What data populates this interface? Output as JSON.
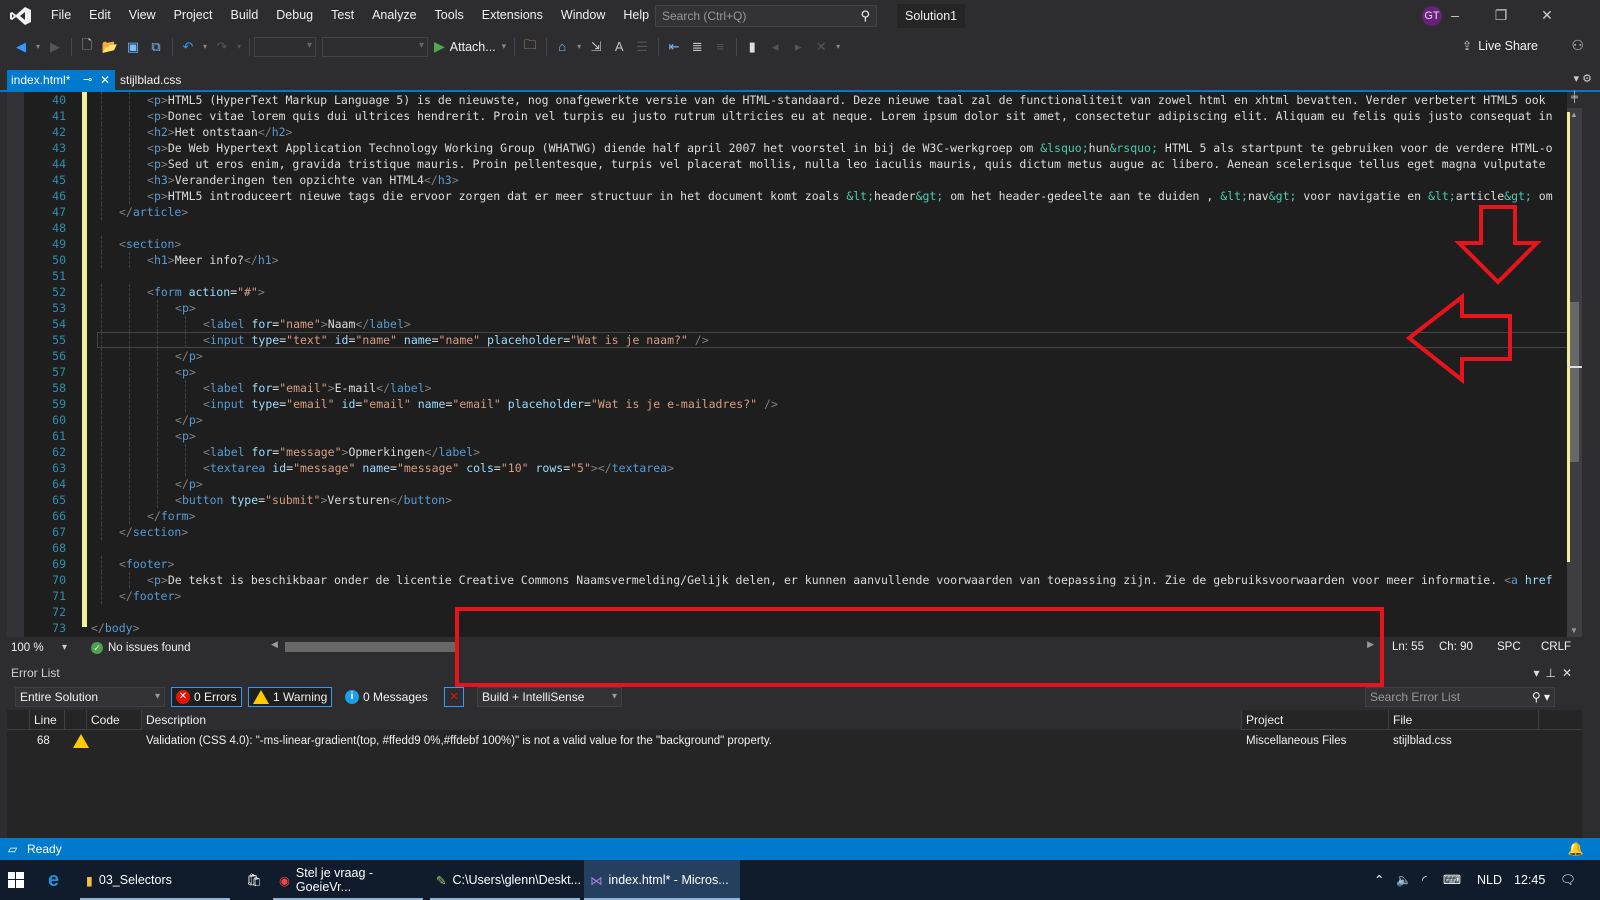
{
  "app": {
    "solution_name": "Solution1",
    "user_initials": "GT",
    "search_placeholder": "Search (Ctrl+Q)",
    "menu": [
      "File",
      "Edit",
      "View",
      "Project",
      "Build",
      "Debug",
      "Test",
      "Analyze",
      "Tools",
      "Extensions",
      "Window",
      "Help"
    ],
    "window_controls": {
      "minimize": "–",
      "restore": "❐",
      "close": "✕"
    }
  },
  "toolbar": {
    "attach_label": "Attach...",
    "live_share_label": "Live Share",
    "icons": [
      "back-icon",
      "forward-icon",
      "new-project-icon",
      "open-file-icon",
      "save-icon",
      "save-all-icon",
      "undo-icon",
      "redo-icon",
      "find-in-files-icon",
      "browser-link-icon",
      "step-into-icon",
      "format-icon",
      "comment-icon",
      "outdent-icon",
      "indent-icon",
      "uncomment-icon",
      "bookmark-icon",
      "prev-bookmark-icon",
      "next-bookmark-icon",
      "clear-bookmarks-icon"
    ]
  },
  "tabs": [
    {
      "label": "index.html*",
      "active": true,
      "pinned": true
    },
    {
      "label": "stijlblad.css",
      "active": false
    }
  ],
  "editor": {
    "lines": [
      {
        "no": "40",
        "indent": 2,
        "html": "<span class='br'>&lt;</span><span class='tag'>p</span><span class='br'>&gt;</span>HTML5 (HyperText Markup Language 5) is de nieuwste, nog onafgewerkte versie van de HTML-standaard. Deze nieuwe taal zal de functionaliteit van zowel html en xhtml bevatten. Verder verbetert HTML5 ook"
      },
      {
        "no": "41",
        "indent": 2,
        "html": "<span class='br'>&lt;</span><span class='tag'>p</span><span class='br'>&gt;</span>Donec vitae lorem quis dui ultrices hendrerit. Proin vel turpis eu justo rutrum ultricies eu at neque. Lorem ipsum dolor sit amet, consectetur adipiscing elit. Aliquam eu felis quis justo consequat in"
      },
      {
        "no": "42",
        "indent": 2,
        "html": "<span class='br'>&lt;</span><span class='tag'>h2</span><span class='br'>&gt;</span>Het ontstaan<span class='br'>&lt;/</span><span class='tag'>h2</span><span class='br'>&gt;</span>"
      },
      {
        "no": "43",
        "indent": 2,
        "html": "<span class='br'>&lt;</span><span class='tag'>p</span><span class='br'>&gt;</span>De Web Hypertext Application Technology Working Group (WHATWG) diende half april 2007 het voorstel in bij de W3C-werkgroep om <span class='ent'>&amp;lsquo;</span>hun<span class='ent'>&amp;rsquo;</span> HTML 5 als startpunt te gebruiken voor de verdere HTML-o"
      },
      {
        "no": "44",
        "indent": 2,
        "html": "<span class='br'>&lt;</span><span class='tag'>p</span><span class='br'>&gt;</span>Sed ut eros enim, gravida tristique mauris. Proin pellentesque, turpis vel placerat mollis, nulla leo iaculis mauris, quis dictum metus augue ac libero. Aenean scelerisque tellus eget magna vulputate"
      },
      {
        "no": "45",
        "indent": 2,
        "html": "<span class='br'>&lt;</span><span class='tag'>h3</span><span class='br'>&gt;</span>Veranderingen ten opzichte van HTML4<span class='br'>&lt;/</span><span class='tag'>h3</span><span class='br'>&gt;</span>"
      },
      {
        "no": "46",
        "indent": 2,
        "html": "<span class='br'>&lt;</span><span class='tag'>p</span><span class='br'>&gt;</span>HTML5 introduceert nieuwe tags die ervoor zorgen dat er meer structuur in het document komt zoals <span class='ent'>&amp;lt;</span>header<span class='ent'>&amp;gt;</span> om het header-gedeelte aan te duiden , <span class='ent'>&amp;lt;</span>nav<span class='ent'>&amp;gt;</span> voor navigatie en <span class='ent'>&amp;lt;</span>article<span class='ent'>&amp;gt;</span> om"
      },
      {
        "no": "47",
        "indent": 1,
        "html": "<span class='br'>&lt;/</span><span class='tag'>article</span><span class='br'>&gt;</span>"
      },
      {
        "no": "48",
        "indent": 0,
        "html": ""
      },
      {
        "no": "49",
        "indent": 1,
        "html": "<span class='br'>&lt;</span><span class='tag'>section</span><span class='br'>&gt;</span>"
      },
      {
        "no": "50",
        "indent": 2,
        "html": "<span class='br'>&lt;</span><span class='tag'>h1</span><span class='br'>&gt;</span>Meer info?<span class='br'>&lt;/</span><span class='tag'>h1</span><span class='br'>&gt;</span>"
      },
      {
        "no": "51",
        "indent": 0,
        "html": ""
      },
      {
        "no": "52",
        "indent": 2,
        "html": "<span class='br'>&lt;</span><span class='tag'>form</span> <span class='attr'>action</span>=<span class='val'>\"#\"</span><span class='br'>&gt;</span>"
      },
      {
        "no": "53",
        "indent": 3,
        "html": "<span class='br'>&lt;</span><span class='tag'>p</span><span class='br'>&gt;</span>"
      },
      {
        "no": "54",
        "indent": 4,
        "html": "<span class='br'>&lt;</span><span class='tag'>label</span> <span class='attr'>for</span>=<span class='val'>\"name\"</span><span class='br'>&gt;</span>Naam<span class='br'>&lt;/</span><span class='tag'>label</span><span class='br'>&gt;</span>"
      },
      {
        "no": "55",
        "indent": 4,
        "html": "<span class='br'>&lt;</span><span class='tag'>input</span> <span class='attr'>type</span>=<span class='val'>\"text\"</span> <span class='attr'>id</span>=<span class='val'>\"name\"</span> <span class='attr'>name</span>=<span class='val'>\"name\"</span> <span class='attr'>placeholder</span>=<span class='val'>\"Wat is je naam?\"</span> <span class='br'>/&gt;</span>"
      },
      {
        "no": "56",
        "indent": 3,
        "html": "<span class='br'>&lt;/</span><span class='tag'>p</span><span class='br'>&gt;</span>"
      },
      {
        "no": "57",
        "indent": 3,
        "html": "<span class='br'>&lt;</span><span class='tag'>p</span><span class='br'>&gt;</span>"
      },
      {
        "no": "58",
        "indent": 4,
        "html": "<span class='br'>&lt;</span><span class='tag'>label</span> <span class='attr'>for</span>=<span class='val'>\"email\"</span><span class='br'>&gt;</span>E-mail<span class='br'>&lt;/</span><span class='tag'>label</span><span class='br'>&gt;</span>"
      },
      {
        "no": "59",
        "indent": 4,
        "html": "<span class='br'>&lt;</span><span class='tag'>input</span> <span class='attr'>type</span>=<span class='val'>\"email\"</span> <span class='attr'>id</span>=<span class='val'>\"email\"</span> <span class='attr'>name</span>=<span class='val'>\"email\"</span> <span class='attr'>placeholder</span>=<span class='val'>\"Wat is je e-mailadres?\"</span> <span class='br'>/&gt;</span>"
      },
      {
        "no": "60",
        "indent": 3,
        "html": "<span class='br'>&lt;/</span><span class='tag'>p</span><span class='br'>&gt;</span>"
      },
      {
        "no": "61",
        "indent": 3,
        "html": "<span class='br'>&lt;</span><span class='tag'>p</span><span class='br'>&gt;</span>"
      },
      {
        "no": "62",
        "indent": 4,
        "html": "<span class='br'>&lt;</span><span class='tag'>label</span> <span class='attr'>for</span>=<span class='val'>\"message\"</span><span class='br'>&gt;</span>Opmerkingen<span class='br'>&lt;/</span><span class='tag'>label</span><span class='br'>&gt;</span>"
      },
      {
        "no": "63",
        "indent": 4,
        "html": "<span class='br'>&lt;</span><span class='tag'>textarea</span> <span class='attr'>id</span>=<span class='val'>\"message\"</span> <span class='attr'>name</span>=<span class='val'>\"message\"</span> <span class='attr'>cols</span>=<span class='val'>\"10\"</span> <span class='attr'>rows</span>=<span class='val'>\"5\"</span><span class='br'>&gt;&lt;/</span><span class='tag'>textarea</span><span class='br'>&gt;</span>"
      },
      {
        "no": "64",
        "indent": 3,
        "html": "<span class='br'>&lt;/</span><span class='tag'>p</span><span class='br'>&gt;</span>"
      },
      {
        "no": "65",
        "indent": 3,
        "html": "<span class='br'>&lt;</span><span class='tag'>button</span> <span class='attr'>type</span>=<span class='val'>\"submit\"</span><span class='br'>&gt;</span>Versturen<span class='br'>&lt;/</span><span class='tag'>button</span><span class='br'>&gt;</span>"
      },
      {
        "no": "66",
        "indent": 2,
        "html": "<span class='br'>&lt;/</span><span class='tag'>form</span><span class='br'>&gt;</span>"
      },
      {
        "no": "67",
        "indent": 1,
        "html": "<span class='br'>&lt;/</span><span class='tag'>section</span><span class='br'>&gt;</span>"
      },
      {
        "no": "68",
        "indent": 0,
        "html": ""
      },
      {
        "no": "69",
        "indent": 1,
        "html": "<span class='br'>&lt;</span><span class='tag'>footer</span><span class='br'>&gt;</span>"
      },
      {
        "no": "70",
        "indent": 2,
        "html": "<span class='br'>&lt;</span><span class='tag'>p</span><span class='br'>&gt;</span>De tekst is beschikbaar onder de licentie Creative Commons Naamsvermelding/Gelijk delen, er kunnen aanvullende voorwaarden van toepassing zijn. Zie de gebruiksvoorwaarden voor meer informatie. <span class='br'>&lt;</span><span class='tag'>a</span> <span class='attr'>href</span>"
      },
      {
        "no": "71",
        "indent": 1,
        "html": "<span class='br'>&lt;/</span><span class='tag'>footer</span><span class='br'>&gt;</span>"
      },
      {
        "no": "72",
        "indent": 0,
        "html": ""
      },
      {
        "no": "73",
        "indent": 0,
        "html": "<span class='br'>&lt;/</span><span class='tag'>body</span><span class='br'>&gt;</span>"
      }
    ],
    "current_line": "55"
  },
  "editor_status": {
    "zoom": "100 %",
    "issues": "No issues found",
    "line": "Ln: 55",
    "col": "Ch: 90",
    "whitespace": "SPC",
    "line_ending": "CRLF"
  },
  "error_list": {
    "title": "Error List",
    "scope": "Entire Solution",
    "errors_label": "0 Errors",
    "warnings_label": "1 Warning",
    "messages_label": "0 Messages",
    "build_filter": "Build + IntelliSense",
    "search_placeholder": "Search Error List",
    "columns": [
      "Line",
      "Code",
      "Description",
      "Project",
      "File"
    ],
    "rows": [
      {
        "severity": "warning",
        "line": "68",
        "code": "",
        "description": "Validation (CSS 4.0): \"-ms-linear-gradient(top,  #ffedd9 0%,#ffdebf 100%)\" is not a valid value for the \"background\" property.",
        "project": "Miscellaneous Files",
        "file": "stijlblad.css"
      }
    ]
  },
  "statusbar": {
    "text": "Ready"
  },
  "taskbar": {
    "apps": [
      {
        "label": "03_Selectors",
        "icon": "folder-icon"
      },
      {
        "label": "Stel je vraag - GoeieVr...",
        "icon": "chrome-icon"
      },
      {
        "label": "C:\\Users\\glenn\\Deskt...",
        "icon": "notepad-icon"
      },
      {
        "label": "index.html* - Micros...",
        "icon": "visual-studio-icon",
        "active": true
      }
    ],
    "language": "NLD",
    "time": "12:45"
  }
}
